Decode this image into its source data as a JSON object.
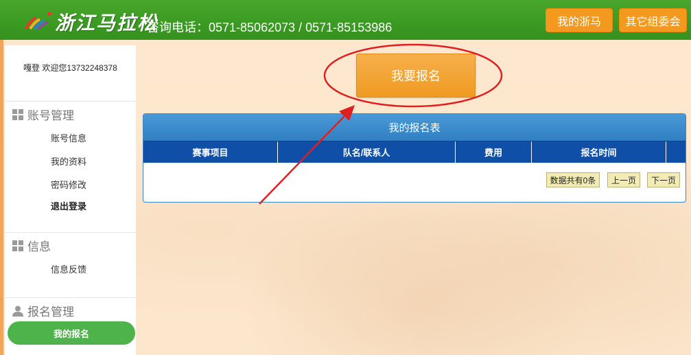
{
  "header": {
    "brand": "浙江马拉松",
    "hotline": "咨询电话：0571-85062073 / 0571-85153986",
    "buttons": [
      "我的浙马",
      "其它组委会"
    ]
  },
  "sidebar": {
    "welcome": "嘎登 欢迎您13732248378",
    "sections": [
      {
        "title": "账号管理",
        "icon": "grid-icon",
        "items": [
          "账号信息",
          "我的资料",
          "密码修改",
          "退出登录"
        ]
      },
      {
        "title": "信息",
        "icon": "grid-icon",
        "items": [
          "信息反馈"
        ]
      },
      {
        "title": "报名管理",
        "icon": "user-icon",
        "items": [
          "我的报名"
        ]
      }
    ],
    "active_item": "我的报名"
  },
  "main": {
    "signup_button": "我要报名",
    "table": {
      "title": "我的报名表",
      "columns": [
        "赛事项目",
        "队名/联系人",
        "费用",
        "报名时间"
      ],
      "rows": []
    },
    "pager": {
      "count_text": "数据共有0条",
      "prev": "上一页",
      "next": "下一页"
    }
  },
  "colors": {
    "header_green": "#3a9a22",
    "accent_orange": "#f39a1e",
    "table_header_blue": "#0f4fa8",
    "active_green": "#4db34a",
    "annotation_red": "#e02020"
  }
}
